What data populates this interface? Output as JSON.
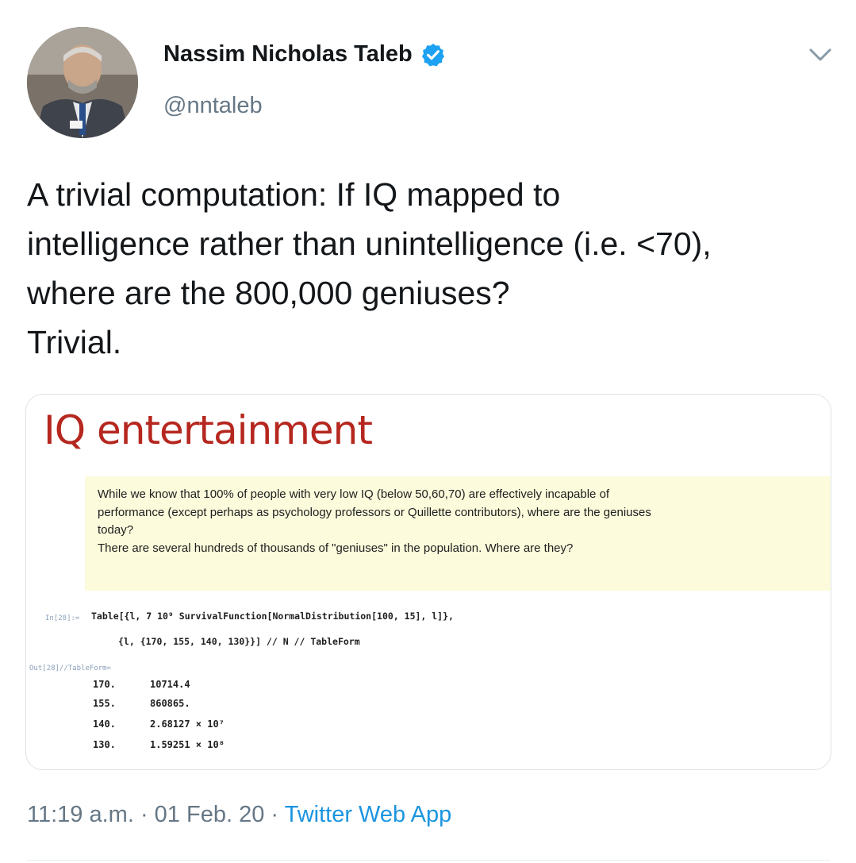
{
  "author": {
    "name": "Nassim Nicholas Taleb",
    "handle": "@nntaleb",
    "verified": true
  },
  "tweet": {
    "lines": [
      "A trivial computation: If IQ mapped to",
      "intelligence rather than unintelligence (i.e. <70),",
      "where are the 800,000 geniuses?",
      "Trivial."
    ]
  },
  "media": {
    "title": "IQ entertainment",
    "note_lines": [
      "While we know that 100% of people with very low IQ (below 50,60,70) are effectively incapable of",
      "performance (except perhaps as psychology professors or Quillette contributors), where are the geniuses",
      "today?",
      "There are several hundreds of thousands of \"geniuses\" in the population. Where are they?"
    ],
    "in_label": "In[28]:=",
    "code_line1": "Table[{l, 7 10⁹ SurvivalFunction[NormalDistribution[100, 15], l]},",
    "code_line2": "{l, {170, 155, 140, 130}}] // N // TableForm",
    "out_label": "Out[28]//TableForm=",
    "table": [
      [
        "170.",
        "10714.4"
      ],
      [
        "155.",
        "860865."
      ],
      [
        "140.",
        "2.68127 × 10⁷"
      ],
      [
        "130.",
        "1.59251 × 10⁸"
      ]
    ]
  },
  "meta": {
    "time": "11:19 a.m.",
    "separator1": " · ",
    "date": "01 Feb. 20",
    "separator2": " · ",
    "source": "Twitter Web App"
  },
  "colors": {
    "verified": "#1da1f2",
    "title_red": "#b5271f",
    "note_bg": "#fcfbdc",
    "link": "#1b95e0",
    "muted": "#657786"
  },
  "icons": {
    "verified": "verified-badge-icon",
    "chevron": "chevron-down-icon"
  }
}
